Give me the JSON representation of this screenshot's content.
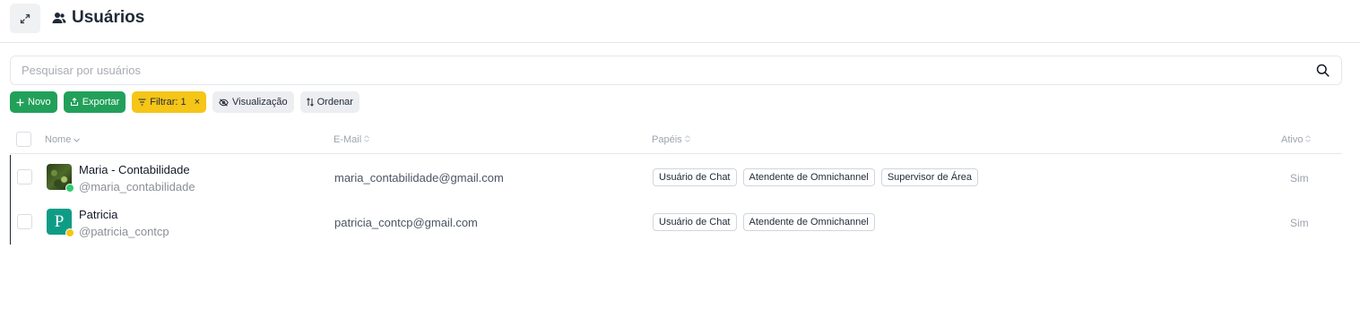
{
  "header": {
    "title": "Usuários",
    "expand_icon": "expand-icon",
    "users_icon": "users-icon"
  },
  "search": {
    "placeholder": "Pesquisar por usuários",
    "value": ""
  },
  "toolbar": {
    "new_label": "Novo",
    "export_label": "Exportar",
    "filter_label": "Filtrar: 1",
    "filter_clear": "×",
    "view_label": "Visualização",
    "sort_label": "Ordenar"
  },
  "table": {
    "columns": {
      "name": "Nome",
      "email": "E-Mail",
      "roles": "Papéis",
      "active": "Ativo"
    },
    "rows": [
      {
        "name": "Maria - Contabilidade",
        "handle": "@maria_contabilidade",
        "email": "maria_contabilidade@gmail.com",
        "roles": [
          "Usuário de Chat",
          "Atendente de Omnichannel",
          "Supervisor de Área"
        ],
        "active": "Sim",
        "status": "online"
      },
      {
        "name": "Patricia",
        "avatar_letter": "P",
        "handle": "@patricia_contcp",
        "email": "patricia_contcp@gmail.com",
        "roles": [
          "Usuário de Chat",
          "Atendente de Omnichannel"
        ],
        "active": "Sim",
        "status": "away"
      }
    ]
  },
  "colors": {
    "green": "#22a05a",
    "yellow": "#f5c518",
    "avatar_teal": "#0f9c86"
  }
}
